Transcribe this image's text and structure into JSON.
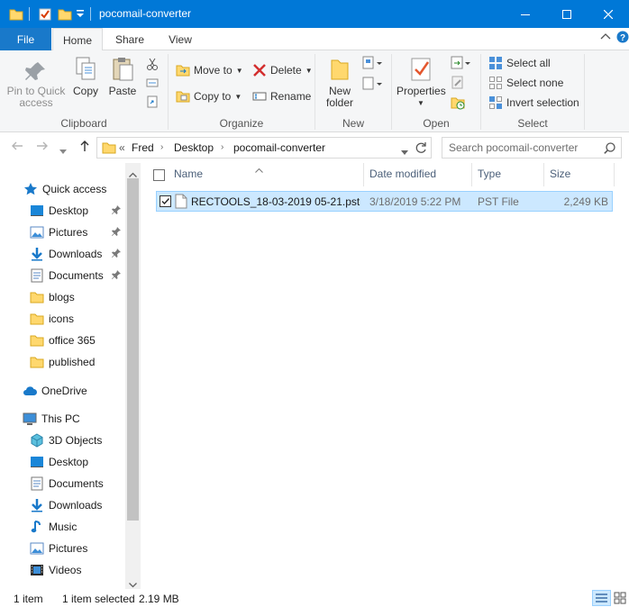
{
  "window": {
    "title": "pocomail-converter",
    "controls": [
      "minimize",
      "maximize",
      "close"
    ]
  },
  "ribbon_tabs": {
    "file": "File",
    "home": "Home",
    "share": "Share",
    "view": "View"
  },
  "ribbon": {
    "clipboard": {
      "label": "Clipboard",
      "pin_to_quick_access_line1": "Pin to Quick",
      "pin_to_quick_access_line2": "access",
      "copy": "Copy",
      "paste": "Paste"
    },
    "organize": {
      "label": "Organize",
      "move_to": "Move to",
      "copy_to": "Copy to",
      "delete": "Delete",
      "rename": "Rename"
    },
    "new": {
      "label": "New",
      "new_folder_line1": "New",
      "new_folder_line2": "folder"
    },
    "open": {
      "label": "Open",
      "properties": "Properties"
    },
    "select": {
      "label": "Select",
      "select_all": "Select all",
      "select_none": "Select none",
      "invert_selection": "Invert selection"
    }
  },
  "address": {
    "overflow": "«",
    "crumbs": [
      "Fred",
      "Desktop",
      "pocomail-converter"
    ],
    "search_placeholder": "Search pocomail-converter"
  },
  "nav_pane": {
    "quick_access": "Quick access",
    "quick_items": [
      {
        "label": "Desktop",
        "icon": "desktop-icon",
        "pinned": true
      },
      {
        "label": "Pictures",
        "icon": "pictures-icon",
        "pinned": true
      },
      {
        "label": "Downloads",
        "icon": "downloads-icon",
        "pinned": true
      },
      {
        "label": "Documents",
        "icon": "documents-icon",
        "pinned": true
      },
      {
        "label": "blogs",
        "icon": "folder-icon",
        "pinned": false
      },
      {
        "label": "icons",
        "icon": "folder-icon",
        "pinned": false
      },
      {
        "label": "office 365",
        "icon": "folder-icon",
        "pinned": false
      },
      {
        "label": "published",
        "icon": "folder-icon",
        "pinned": false
      }
    ],
    "onedrive": "OneDrive",
    "this_pc": "This PC",
    "pc_items": [
      {
        "label": "3D Objects",
        "icon": "3d-objects-icon"
      },
      {
        "label": "Desktop",
        "icon": "desktop-icon"
      },
      {
        "label": "Documents",
        "icon": "documents-icon"
      },
      {
        "label": "Downloads",
        "icon": "downloads-icon"
      },
      {
        "label": "Music",
        "icon": "music-icon"
      },
      {
        "label": "Pictures",
        "icon": "pictures-icon"
      },
      {
        "label": "Videos",
        "icon": "videos-icon"
      }
    ]
  },
  "columns": {
    "name": "Name",
    "date": "Date modified",
    "type": "Type",
    "size": "Size"
  },
  "files": [
    {
      "name": "RECTOOLS_18-03-2019 05-21.pst",
      "date": "3/18/2019 5:22 PM",
      "type": "PST File",
      "size": "2,249 KB",
      "selected": true
    }
  ],
  "status": {
    "count": "1 item",
    "selected": "1 item selected",
    "size": "2.19 MB"
  },
  "colors": {
    "titlebar": "#0078d7",
    "file_tab": "#1979ca",
    "selection_fill": "#cce8ff",
    "selection_border": "#99d1ff",
    "folder": "#ffd86e"
  }
}
